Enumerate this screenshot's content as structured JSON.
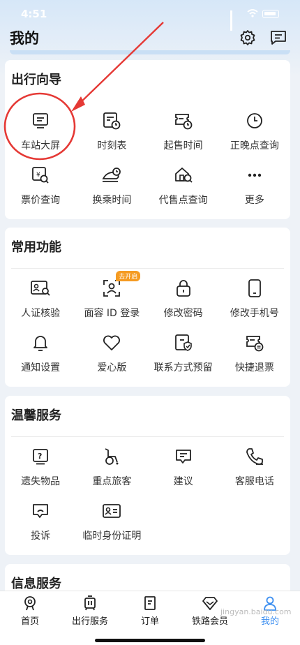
{
  "status_bar": {
    "time": "4:51"
  },
  "header": {
    "title": "我的",
    "settings_icon": "gear-icon",
    "message_icon": "message-icon"
  },
  "sections": [
    {
      "title": "出行向导",
      "items": [
        {
          "label": "车站大屏",
          "icon": "station-screen-icon"
        },
        {
          "label": "时刻表",
          "icon": "timetable-icon"
        },
        {
          "label": "起售时间",
          "icon": "sale-time-icon"
        },
        {
          "label": "正晚点查询",
          "icon": "clock-icon"
        },
        {
          "label": "票价查询",
          "icon": "fare-query-icon"
        },
        {
          "label": "换乘时间",
          "icon": "transfer-icon"
        },
        {
          "label": "代售点查询",
          "icon": "agent-point-icon"
        },
        {
          "label": "更多",
          "icon": "more-icon"
        }
      ]
    },
    {
      "title": "常用功能",
      "items": [
        {
          "label": "人证核验",
          "icon": "id-verify-icon"
        },
        {
          "label": "面容 ID 登录",
          "icon": "face-id-icon",
          "badge": "去开启"
        },
        {
          "label": "修改密码",
          "icon": "lock-icon"
        },
        {
          "label": "修改手机号",
          "icon": "phone-icon"
        },
        {
          "label": "通知设置",
          "icon": "bell-icon"
        },
        {
          "label": "爱心版",
          "icon": "heart-icon"
        },
        {
          "label": "联系方式预留",
          "icon": "contact-reserve-icon"
        },
        {
          "label": "快捷退票",
          "icon": "quick-refund-icon"
        }
      ]
    },
    {
      "title": "温馨服务",
      "items": [
        {
          "label": "遗失物品",
          "icon": "lost-item-icon"
        },
        {
          "label": "重点旅客",
          "icon": "wheelchair-icon"
        },
        {
          "label": "建议",
          "icon": "suggestion-icon"
        },
        {
          "label": "客服电话",
          "icon": "customer-phone-icon"
        },
        {
          "label": "投诉",
          "icon": "complaint-icon"
        },
        {
          "label": "临时身份证明",
          "icon": "temp-id-icon"
        }
      ]
    },
    {
      "title": "信息服务",
      "items": []
    }
  ],
  "tabbar": [
    {
      "label": "首页",
      "icon": "home-icon",
      "active": false
    },
    {
      "label": "出行服务",
      "icon": "travel-service-icon",
      "active": false
    },
    {
      "label": "订单",
      "icon": "order-icon",
      "active": false
    },
    {
      "label": "铁路会员",
      "icon": "member-icon",
      "active": false
    },
    {
      "label": "我的",
      "icon": "user-icon",
      "active": true
    }
  ],
  "colors": {
    "accent": "#3b8ef0",
    "annotation": "#e53935",
    "badge": "#f59b22"
  },
  "watermark": "jingyan.baidu.com"
}
